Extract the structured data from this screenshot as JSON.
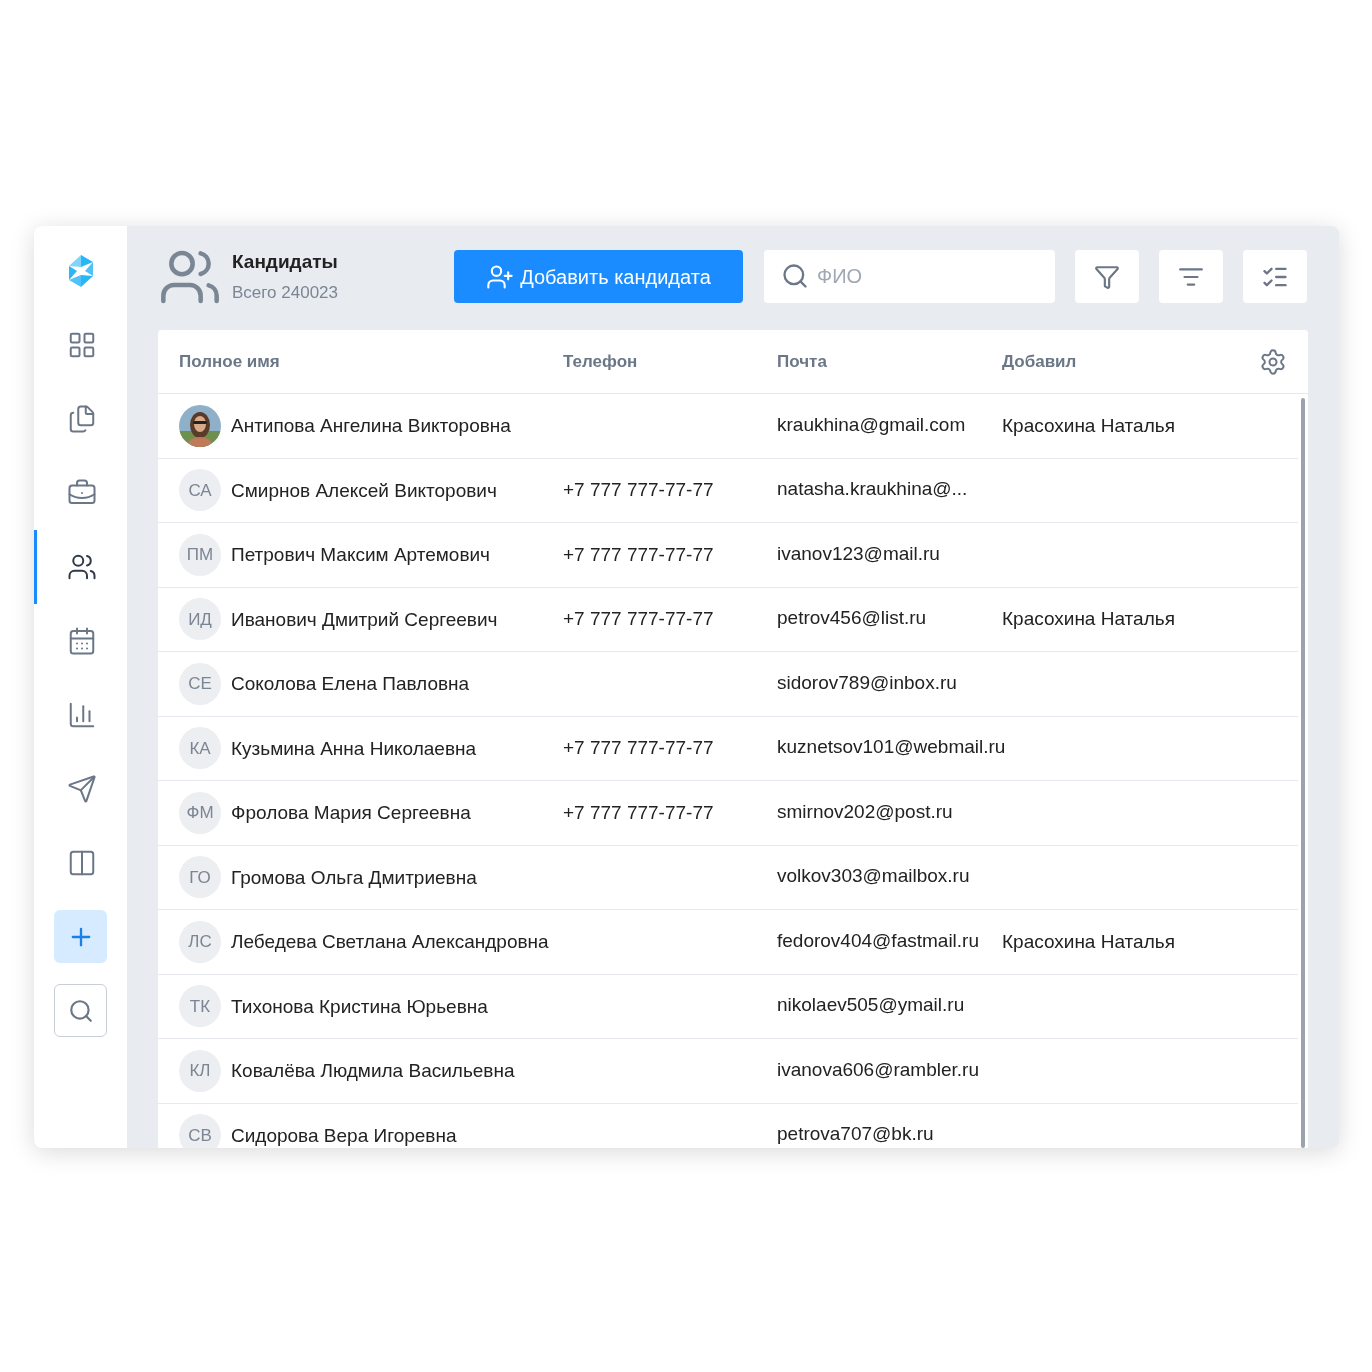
{
  "sidebar": {
    "items": [
      {
        "kind": "widgets",
        "selected": false
      },
      {
        "kind": "documents",
        "selected": false
      },
      {
        "kind": "vacancies",
        "selected": false
      },
      {
        "kind": "candidates",
        "selected": true
      },
      {
        "kind": "calendar",
        "selected": false
      },
      {
        "kind": "reports",
        "selected": false
      },
      {
        "kind": "mailing",
        "selected": false
      },
      {
        "kind": "board",
        "selected": false
      }
    ]
  },
  "header": {
    "title": "Кандидаты",
    "subtitle": "Всего 240023",
    "add_button": "Добавить кандидата",
    "search": {
      "placeholder": "ФИО"
    }
  },
  "table": {
    "columns": [
      "Полное имя",
      "Телефон",
      "Почта",
      "Добавил"
    ],
    "rows": [
      {
        "name": "Антипова Ангелина Викторовна",
        "phone": "",
        "email": "kraukhina@gmail.com",
        "added_by": "Красохина Наталья"
      },
      {
        "avatar": {
          "kind": "initials",
          "text": "СА"
        },
        "name": "Смирнов Алексей Викторович",
        "phone": "+7 777 777-77-77",
        "email": "natasha.kraukhina@...",
        "added_by": ""
      },
      {
        "avatar": {
          "kind": "initials",
          "text": "ПМ"
        },
        "name": "Петрович Максим Артемович",
        "phone": "+7 777 777-77-77",
        "email": "ivanov123@mail.ru",
        "added_by": ""
      },
      {
        "avatar": {
          "kind": "initials",
          "text": "ИД"
        },
        "name": "Иванович Дмитрий Сергеевич",
        "phone": "+7 777 777-77-77",
        "email": "petrov456@list.ru",
        "added_by": "Красохина Наталья"
      },
      {
        "avatar": {
          "kind": "initials",
          "text": "СЕ"
        },
        "name": "Соколова Елена Павловна",
        "phone": "",
        "email": "sidorov789@inbox.ru",
        "added_by": ""
      },
      {
        "avatar": {
          "kind": "initials",
          "text": "КА"
        },
        "name": "Кузьмина Анна Николаевна",
        "phone": "+7 777 777-77-77",
        "email": "kuznetsov101@webmail.ru",
        "added_by": ""
      },
      {
        "avatar": {
          "kind": "initials",
          "text": "ФМ"
        },
        "name": "Фролова Мария Сергеевна",
        "phone": "+7 777 777-77-77",
        "email": "smirnov202@post.ru",
        "added_by": ""
      },
      {
        "avatar": {
          "kind": "initials",
          "text": "ГО"
        },
        "name": "Громова Ольга Дмитриевна",
        "phone": "",
        "email": "volkov303@mailbox.ru",
        "added_by": ""
      },
      {
        "avatar": {
          "kind": "initials",
          "text": "ЛС"
        },
        "name": "Лебедева Светлана Александровна",
        "phone": "",
        "email": "fedorov404@fastmail.ru",
        "added_by": "Красохина Наталья"
      },
      {
        "avatar": {
          "kind": "initials",
          "text": "ТК"
        },
        "name": "Тихонова Кристина Юрьевна",
        "phone": "",
        "email": "nikolaev505@ymail.ru",
        "added_by": ""
      },
      {
        "avatar": {
          "kind": "initials",
          "text": "КЛ"
        },
        "name": "Ковалёва Людмила Васильевна",
        "phone": "",
        "email": "ivanova606@rambler.ru",
        "added_by": ""
      },
      {
        "avatar": {
          "kind": "initials",
          "text": "СВ"
        },
        "name": "Сидорова Вера Игоревна",
        "phone": "",
        "email": "petrova707@bk.ru",
        "added_by": ""
      }
    ]
  }
}
